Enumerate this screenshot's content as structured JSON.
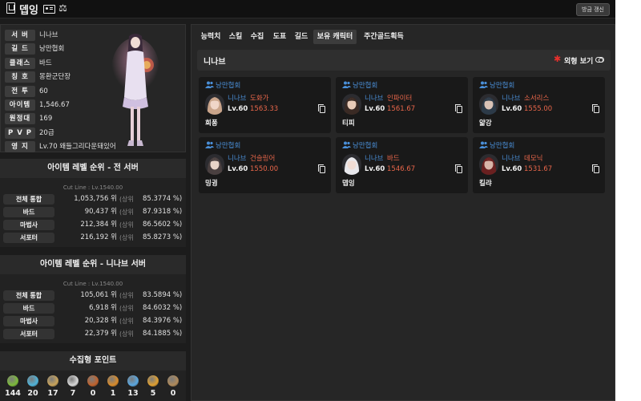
{
  "header": {
    "title": "뎁잉",
    "refresh_label": "방금 갱신"
  },
  "profile": {
    "rows": [
      {
        "label": "서 버",
        "value": "니나브"
      },
      {
        "label": "길 드",
        "value": "낭만협회"
      },
      {
        "label": "클래스",
        "value": "바드"
      },
      {
        "label": "칭 호",
        "value": "몽환군단장"
      },
      {
        "label": "전 투",
        "value": "60"
      },
      {
        "label": "아이템",
        "value": "1,546.67"
      },
      {
        "label": "원정대",
        "value": "169"
      },
      {
        "label": "P V P",
        "value": "20급"
      },
      {
        "label": "영 지",
        "value": "Lv.70 왜들그리다운돼있어"
      }
    ]
  },
  "rank_all": {
    "title": "아이템 레벨 순위 - 전 서버",
    "cutline": "Cut Line : Lv.1540.00",
    "rows": [
      {
        "label": "전체 통합",
        "rank": "1,053,756 위",
        "upper": "(상위",
        "pct": "85.3774 %)"
      },
      {
        "label": "바드",
        "rank": "90,437 위",
        "upper": "(상위",
        "pct": "87.9318 %)"
      },
      {
        "label": "마법사",
        "rank": "212,384 위",
        "upper": "(상위",
        "pct": "86.5602 %)"
      },
      {
        "label": "서포터",
        "rank": "216,192 위",
        "upper": "(상위",
        "pct": "85.8273 %)"
      }
    ]
  },
  "rank_server": {
    "title": "아이템 레벨 순위 - 니나브 서버",
    "cutline": "Cut Line : Lv.1540.00",
    "rows": [
      {
        "label": "전체 통합",
        "rank": "105,061 위",
        "upper": "(상위",
        "pct": "83.5894 %)"
      },
      {
        "label": "바드",
        "rank": "6,918 위",
        "upper": "(상위",
        "pct": "84.6032 %)"
      },
      {
        "label": "마법사",
        "rank": "20,328 위",
        "upper": "(상위",
        "pct": "84.3976 %)"
      },
      {
        "label": "서포터",
        "rank": "22,379 위",
        "upper": "(상위",
        "pct": "84.1885 %)"
      }
    ]
  },
  "collect": {
    "title": "수집형 포인트",
    "items": [
      {
        "icon": "mokoko-seed-icon",
        "color": "#7dbb3a",
        "count": "144"
      },
      {
        "icon": "island-heart-icon",
        "color": "#4fb3d9",
        "count": "20"
      },
      {
        "icon": "great-art-icon",
        "color": "#c9a35a",
        "count": "17"
      },
      {
        "icon": "giant-heart-icon",
        "color": "#d8d8d8",
        "count": "7"
      },
      {
        "icon": "ignea-token-icon",
        "color": "#c0622c",
        "count": "0"
      },
      {
        "icon": "adventure-tome-icon",
        "color": "#d98b2a",
        "count": "1"
      },
      {
        "icon": "orpheus-star-icon",
        "color": "#5aa7e0",
        "count": "13"
      },
      {
        "icon": "sea-bounty-icon",
        "color": "#e0a030",
        "count": "5"
      },
      {
        "icon": "world-tree-leaf-icon",
        "color": "#b08a5a",
        "count": "0"
      }
    ]
  },
  "tabs": [
    "능력치",
    "스킬",
    "수집",
    "도표",
    "길드",
    "보유 캐릭터",
    "주간골드획득"
  ],
  "active_tab": "보유 캐릭터",
  "roster": {
    "server": "니나브",
    "look_label": "외형 보기",
    "characters": [
      {
        "guild": "낭만협회",
        "server": "니나브",
        "class": "도화가",
        "level": "Lv.60",
        "ilvl": "1563.33",
        "name": "희퐁",
        "hair": "#c9a48a",
        "skin": "#f0d6c8"
      },
      {
        "guild": "낭만협회",
        "server": "니나브",
        "class": "인파이터",
        "level": "Lv.60",
        "ilvl": "1561.67",
        "name": "티피",
        "hair": "#3a2a24",
        "skin": "#e8cbb8"
      },
      {
        "guild": "낭만협회",
        "server": "니나브",
        "class": "소서리스",
        "level": "Lv.60",
        "ilvl": "1555.00",
        "name": "얇강",
        "hair": "#2c3a48",
        "skin": "#d9c2b6"
      },
      {
        "guild": "낭만협회",
        "server": "니나브",
        "class": "건슬링어",
        "level": "Lv.60",
        "ilvl": "1550.00",
        "name": "밍귕",
        "hair": "#4a4040",
        "skin": "#e8d4c8"
      },
      {
        "guild": "낭만협회",
        "server": "니나브",
        "class": "바드",
        "level": "Lv.60",
        "ilvl": "1546.67",
        "name": "뎁잉",
        "hair": "#e8e8ec",
        "skin": "#f0dcd4"
      },
      {
        "guild": "낭만협회",
        "server": "니나브",
        "class": "데모닉",
        "level": "Lv.60",
        "ilvl": "1531.67",
        "name": "킬랴",
        "hair": "#6a2020",
        "skin": "#d8b4a8"
      }
    ]
  }
}
